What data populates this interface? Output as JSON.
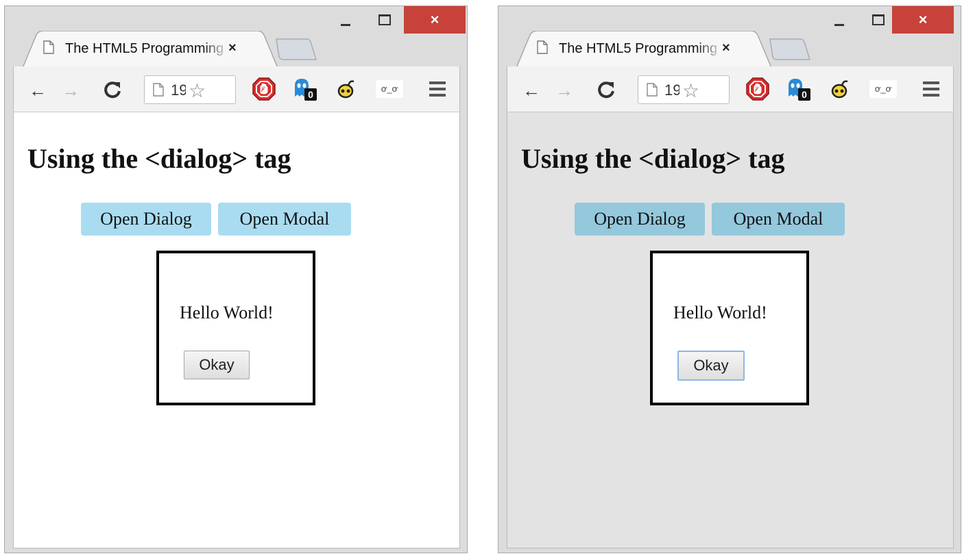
{
  "windows": [
    {
      "tab_title": "The HTML5 Programming",
      "tab_close": "×",
      "address_text": "19",
      "controls": {
        "close": "×"
      },
      "page": {
        "heading": "Using the <dialog> tag",
        "open_dialog_label": "Open Dialog",
        "open_modal_label": "Open Modal",
        "dialog_text": "Hello World!",
        "okay_label": "Okay"
      },
      "background": "#ffffff"
    },
    {
      "tab_title": "The HTML5 Programming",
      "tab_close": "×",
      "address_text": "19",
      "controls": {
        "close": "×"
      },
      "page": {
        "heading": "Using the <dialog> tag",
        "open_dialog_label": "Open Dialog",
        "open_modal_label": "Open Modal",
        "dialog_text": "Hello World!",
        "okay_label": "Okay"
      },
      "background": "#e3e3e3"
    }
  ],
  "extension_badge": "0",
  "extension_face_text": "ơ_ơ",
  "colors": {
    "close_button": "#c7423a",
    "dialog_button_light": "#a9dcf1",
    "dialog_button_dark": "#94c8dd"
  }
}
